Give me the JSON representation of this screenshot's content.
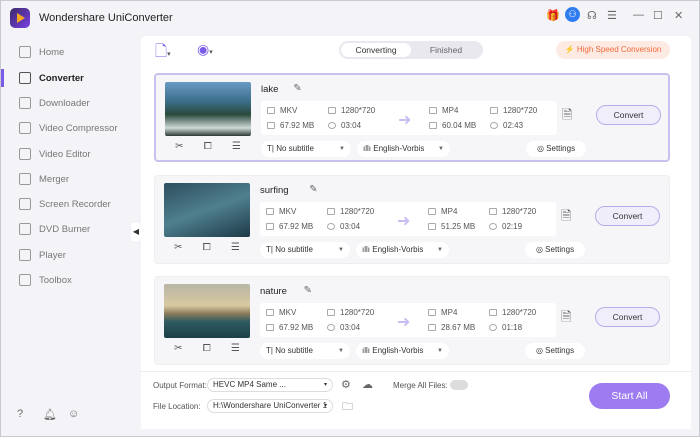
{
  "app": {
    "title": "Wondershare UniConverter"
  },
  "sidebar": {
    "items": [
      {
        "label": "Home"
      },
      {
        "label": "Converter"
      },
      {
        "label": "Downloader"
      },
      {
        "label": "Video Compressor"
      },
      {
        "label": "Video Editor"
      },
      {
        "label": "Merger"
      },
      {
        "label": "Screen Recorder"
      },
      {
        "label": "DVD Burner"
      },
      {
        "label": "Player"
      },
      {
        "label": "Toolbox"
      }
    ]
  },
  "tabs": {
    "converting": "Converting",
    "finished": "Finished"
  },
  "high_speed": "High Speed Conversion",
  "files": [
    {
      "name": "lake",
      "src_format": "MKV",
      "src_res": "1280*720",
      "src_size": "67.92 MB",
      "src_dur": "03:04",
      "dst_format": "MP4",
      "dst_res": "1280*720",
      "dst_size": "60.04 MB",
      "dst_dur": "02:43",
      "subtitle": "No subtitle",
      "audio": "English-Vorbis",
      "settings": "Settings",
      "convert": "Convert"
    },
    {
      "name": "surfing",
      "src_format": "MKV",
      "src_res": "1280*720",
      "src_size": "67.92 MB",
      "src_dur": "03:04",
      "dst_format": "MP4",
      "dst_res": "1280*720",
      "dst_size": "51.25 MB",
      "dst_dur": "02:19",
      "subtitle": "No subtitle",
      "audio": "English-Vorbis",
      "settings": "Settings",
      "convert": "Convert"
    },
    {
      "name": "nature",
      "src_format": "MKV",
      "src_res": "1280*720",
      "src_size": "67.92 MB",
      "src_dur": "03:04",
      "dst_format": "MP4",
      "dst_res": "1280*720",
      "dst_size": "28.67 MB",
      "dst_dur": "01:18",
      "subtitle": "No subtitle",
      "audio": "English-Vorbis",
      "settings": "Settings",
      "convert": "Convert"
    }
  ],
  "bottom": {
    "output_format_label": "Output Format:",
    "output_format": "HEVC MP4 Same ...",
    "file_location_label": "File Location:",
    "file_location": "H:\\Wondershare UniConverter 1",
    "merge_label": "Merge All Files:",
    "merge_on": false,
    "start_all": "Start All"
  },
  "colors": {
    "accent": "#9d7bf0",
    "high_speed": "#f06a3b"
  }
}
